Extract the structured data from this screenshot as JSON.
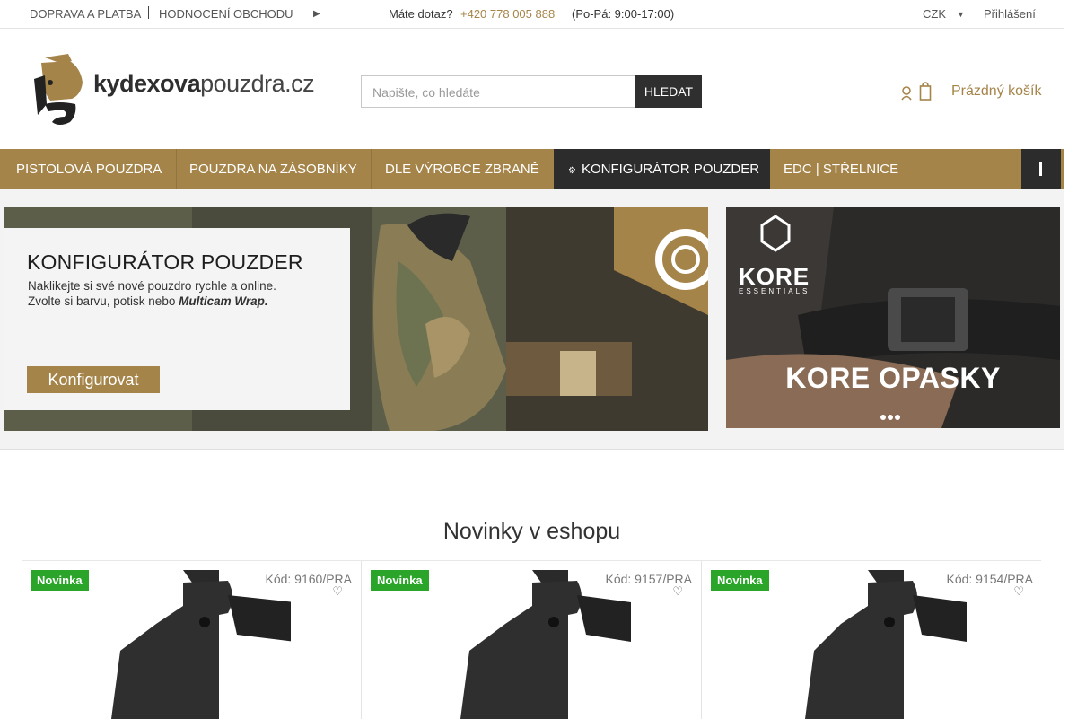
{
  "topbar": {
    "shipping": "DOPRAVA A PLATBA",
    "reviews": "HODNOCENÍ OBCHODU",
    "question": "Máte dotaz?",
    "phone": "+420 778 005 888",
    "hours": "(Po-Pá: 9:00-17:00)",
    "currency": "CZK",
    "login": "Přihlášení"
  },
  "header": {
    "logo_bold": "kydexova",
    "logo_light": "pouzdra.cz",
    "search_placeholder": "Napište, co hledáte",
    "search_button": "HLEDAT",
    "cart_label": "Prázdný košík"
  },
  "nav": {
    "items": [
      {
        "label": "PISTOLOVÁ POUZDRA"
      },
      {
        "label": "POUZDRA NA ZÁSOBNÍKY"
      },
      {
        "label": "DLE VÝROBCE ZBRANĚ"
      },
      {
        "label": "KONFIGURÁTOR POUZDER"
      },
      {
        "label": "EDC | STŘELNICE"
      }
    ]
  },
  "banner_main": {
    "title": "KONFIGURÁTOR POUZDER",
    "line1": "Naklikejte si své nové pouzdro rychle a online.",
    "line2_prefix": "Zvolte si barvu, potisk nebo ",
    "line2_em": "Multicam Wrap.",
    "button": "Konfigurovat"
  },
  "banner_side": {
    "brand": "KORE",
    "brand_sub": "ESSENTIALS",
    "title": "KORE OPASKY"
  },
  "section": {
    "title": "Novinky v eshopu"
  },
  "products": [
    {
      "badge": "Novinka",
      "code": "Kód: 9160/PRA"
    },
    {
      "badge": "Novinka",
      "code": "Kód: 9157/PRA"
    },
    {
      "badge": "Novinka",
      "code": "Kód: 9154/PRA"
    }
  ],
  "colors": {
    "accent": "#a58449",
    "dark": "#2c2c2c",
    "badge": "#2aa52a"
  }
}
